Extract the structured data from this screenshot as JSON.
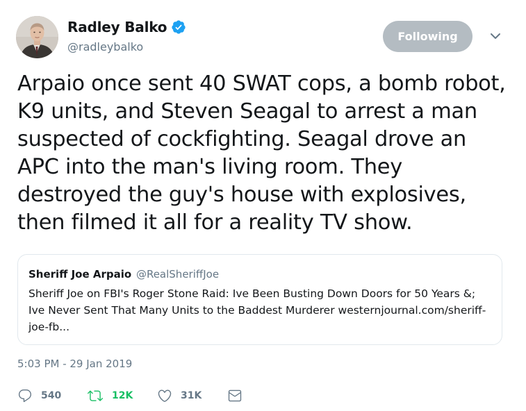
{
  "author": {
    "display_name": "Radley Balko",
    "handle": "@radleybalko",
    "verified_icon": "verified-badge-icon"
  },
  "follow_button": {
    "label": "Following"
  },
  "tweet": {
    "text": "Arpaio once sent 40 SWAT cops, a bomb robot, K9 units, and Steven Seagal to arrest a man suspected of cockfighting. Seagal drove an APC into the man's living room. They destroyed the guy's house with explosives, then filmed it all for a reality TV show.",
    "timestamp": "5:03 PM - 29 Jan 2019"
  },
  "quoted_tweet": {
    "display_name": "Sheriff Joe Arpaio",
    "handle": "@RealSheriffJoe",
    "text": "Sheriff Joe on FBI's Roger Stone Raid: Ive Been Busting Down Doors for 50 Years &; Ive Never Sent That Many Units to the Baddest Murderer westernjournal.com/sheriff-joe-fb..."
  },
  "actions": {
    "replies": "540",
    "retweets": "12K",
    "likes": "31K"
  },
  "colors": {
    "text_primary": "#14171a",
    "text_secondary": "#657786",
    "verified_blue": "#1da1f2",
    "retweet_green": "#17bf63",
    "following_button_bg": "#b4bcc2",
    "border": "#e1e8ed"
  }
}
